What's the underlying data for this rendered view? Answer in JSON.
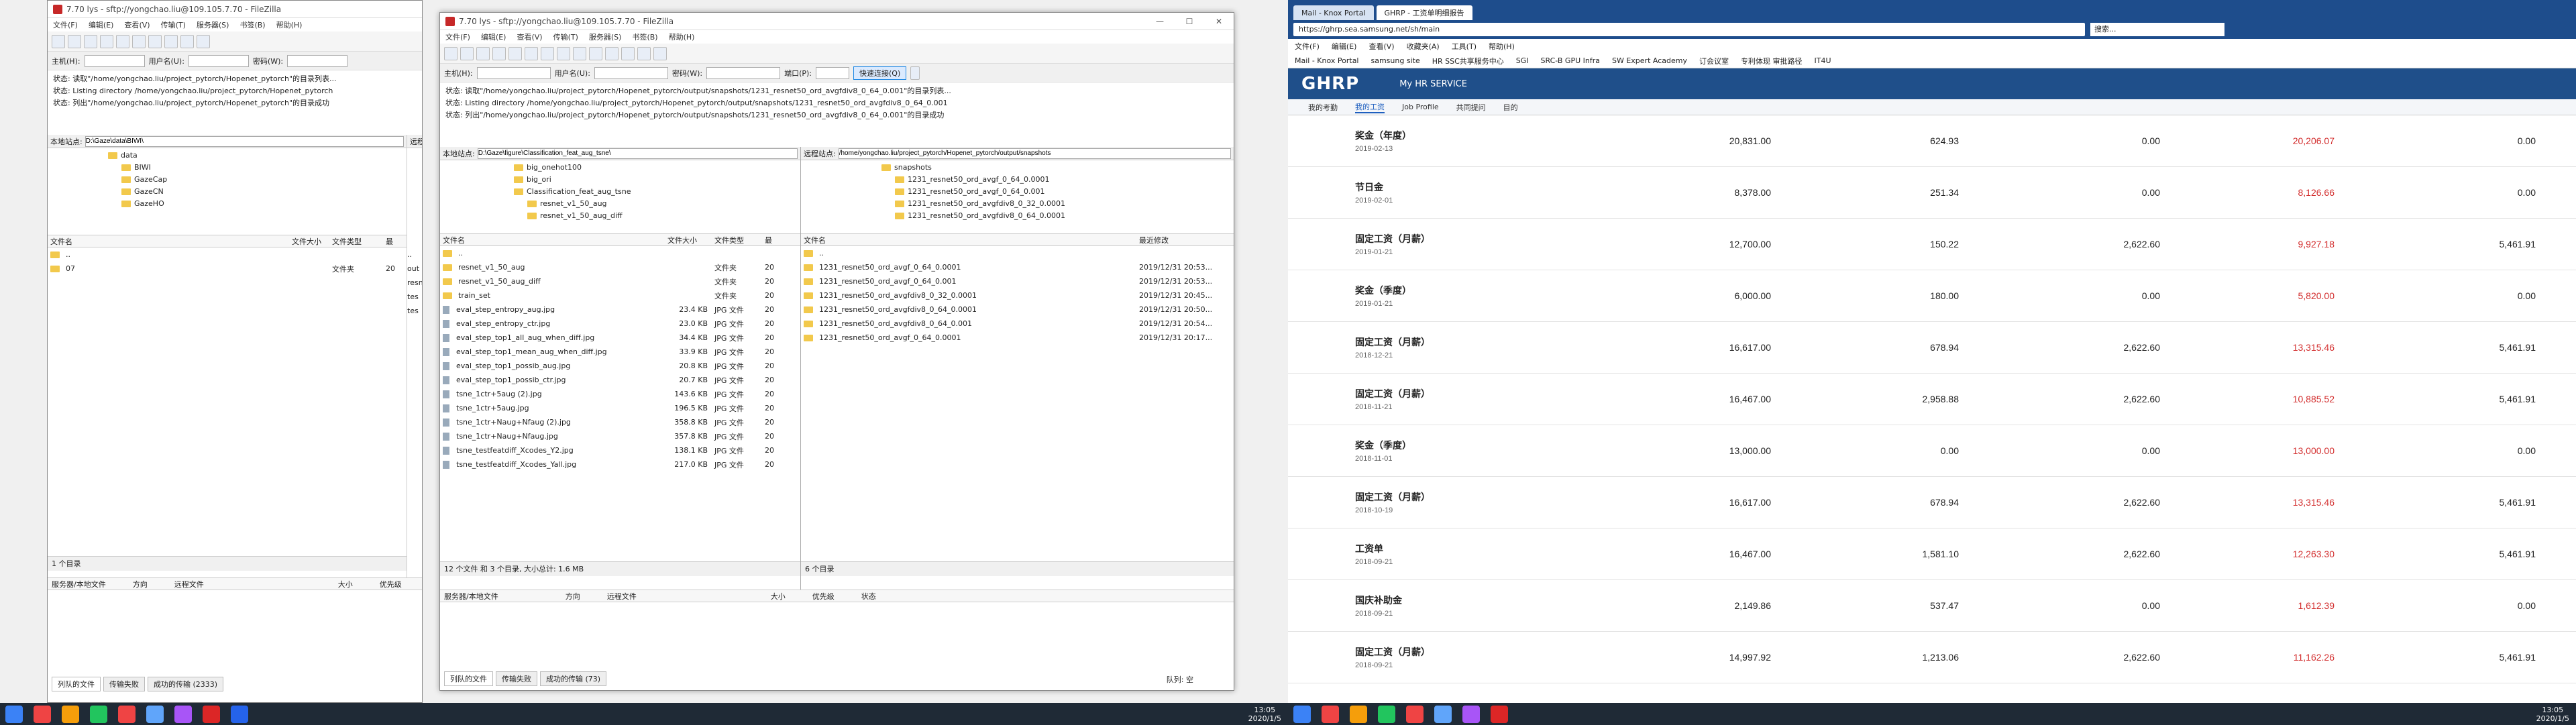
{
  "win1": {
    "title": "7.70 lys - sftp://yongchao.liu@109.105.7.70 - FileZilla",
    "menu": [
      "文件(F)",
      "编辑(E)",
      "查看(V)",
      "传输(T)",
      "服务器(S)",
      "书签(B)",
      "帮助(H)"
    ],
    "qc": {
      "host": "主机(H):",
      "user": "用户名(U):",
      "pass": "密码(W):"
    },
    "log": [
      "状态: 读取\"/home/yongchao.liu/project_pytorch/Hopenet_pytorch\"的目录列表...",
      "状态: Listing directory /home/yongchao.liu/project_pytorch/Hopenet_pytorch",
      "状态: 列出\"/home/yongchao.liu/project_pytorch/Hopenet_pytorch\"的目录成功"
    ],
    "local_label": "本地站点:",
    "local_path": "D:\\Gaze\\data\\BIWI\\",
    "remote_label": "远程站",
    "tree": [
      "data",
      "BIWI",
      "GazeCap",
      "GazeCN",
      "GazeHO"
    ],
    "cols": [
      "文件名",
      "文件大小",
      "文件类型",
      "最"
    ],
    "files": [
      {
        "name": "..",
        "size": "",
        "type": "",
        "date": ""
      },
      {
        "name": "07",
        "size": "",
        "type": "文件夹",
        "date": "20"
      }
    ],
    "remote_items": [
      "..",
      "out",
      "resne",
      "tes",
      "tes"
    ],
    "count": "1 个目录",
    "remote_count": "1 个",
    "qhead": [
      "服务器/本地文件",
      "方向",
      "远程文件",
      "大小",
      "优先级"
    ],
    "tabs": [
      "列队的文件",
      "传输失败",
      "成功的传输 (2333)"
    ]
  },
  "win2": {
    "title": "7.70 lys - sftp://yongchao.liu@109.105.7.70 - FileZilla",
    "menu": [
      "文件(F)",
      "编辑(E)",
      "查看(V)",
      "传输(T)",
      "服务器(S)",
      "书签(B)",
      "帮助(H)"
    ],
    "qc": {
      "host": "主机(H):",
      "user": "用户名(U):",
      "pass": "密码(W):",
      "port": "端口(P):",
      "btn": "快速连接(Q)"
    },
    "log": [
      "状态: 读取\"/home/yongchao.liu/project_pytorch/Hopenet_pytorch/output/snapshots/1231_resnet50_ord_avgfdiv8_0_64_0.001\"的目录列表...",
      "状态: Listing directory /home/yongchao.liu/project_pytorch/Hopenet_pytorch/output/snapshots/1231_resnet50_ord_avgfdiv8_0_64_0.001",
      "状态: 列出\"/home/yongchao.liu/project_pytorch/Hopenet_pytorch/output/snapshots/1231_resnet50_ord_avgfdiv8_0_64_0.001\"的目录成功"
    ],
    "local_label": "本地站点:",
    "local_path": "D:\\Gaze\\figure\\Classification_feat_aug_tsne\\",
    "remote_label": "远程站点:",
    "remote_path": "/home/yongchao.liu/project_pytorch/Hopenet_pytorch/output/snapshots",
    "ltree": [
      "big_onehot100",
      "big_ori",
      "Classification_feat_aug_tsne",
      "resnet_v1_50_aug",
      "resnet_v1_50_aug_diff"
    ],
    "rtree": [
      "snapshots",
      "1231_resnet50_ord_avgf_0_64_0.0001",
      "1231_resnet50_ord_avgf_0_64_0.001",
      "1231_resnet50_ord_avgfdiv8_0_32_0.0001",
      "1231_resnet50_ord_avgfdiv8_0_64_0.0001"
    ],
    "lcols": [
      "文件名",
      "文件大小",
      "文件类型",
      "最"
    ],
    "lfiles": [
      {
        "name": "..",
        "size": "",
        "type": "",
        "d": ""
      },
      {
        "name": "resnet_v1_50_aug",
        "size": "",
        "type": "文件夹",
        "d": "20"
      },
      {
        "name": "resnet_v1_50_aug_diff",
        "size": "",
        "type": "文件夹",
        "d": "20"
      },
      {
        "name": "train_set",
        "size": "",
        "type": "文件夹",
        "d": "20"
      },
      {
        "name": "eval_step_entropy_aug.jpg",
        "size": "23.4 KB",
        "type": "JPG 文件",
        "d": "20"
      },
      {
        "name": "eval_step_entropy_ctr.jpg",
        "size": "23.0 KB",
        "type": "JPG 文件",
        "d": "20"
      },
      {
        "name": "eval_step_top1_all_aug_when_diff.jpg",
        "size": "34.4 KB",
        "type": "JPG 文件",
        "d": "20"
      },
      {
        "name": "eval_step_top1_mean_aug_when_diff.jpg",
        "size": "33.9 KB",
        "type": "JPG 文件",
        "d": "20"
      },
      {
        "name": "eval_step_top1_possib_aug.jpg",
        "size": "20.8 KB",
        "type": "JPG 文件",
        "d": "20"
      },
      {
        "name": "eval_step_top1_possib_ctr.jpg",
        "size": "20.7 KB",
        "type": "JPG 文件",
        "d": "20"
      },
      {
        "name": "tsne_1ctr+5aug (2).jpg",
        "size": "143.6 KB",
        "type": "JPG 文件",
        "d": "20"
      },
      {
        "name": "tsne_1ctr+5aug.jpg",
        "size": "196.5 KB",
        "type": "JPG 文件",
        "d": "20"
      },
      {
        "name": "tsne_1ctr+Naug+Nfaug (2).jpg",
        "size": "358.8 KB",
        "type": "JPG 文件",
        "d": "20"
      },
      {
        "name": "tsne_1ctr+Naug+Nfaug.jpg",
        "size": "357.8 KB",
        "type": "JPG 文件",
        "d": "20"
      },
      {
        "name": "tsne_testfeatdiff_Xcodes_Y2.jpg",
        "size": "138.1 KB",
        "type": "JPG 文件",
        "d": "20"
      },
      {
        "name": "tsne_testfeatdiff_Xcodes_Yall.jpg",
        "size": "217.0 KB",
        "type": "JPG 文件",
        "d": "20"
      }
    ],
    "rcols": [
      "文件名",
      "最近修改"
    ],
    "rfiles": [
      {
        "name": "..",
        "d": ""
      },
      {
        "name": "1231_resnet50_ord_avgf_0_64_0.0001",
        "d": "2019/12/31 20:53..."
      },
      {
        "name": "1231_resnet50_ord_avgf_0_64_0.001",
        "d": "2019/12/31 20:53..."
      },
      {
        "name": "1231_resnet50_ord_avgfdiv8_0_32_0.0001",
        "d": "2019/12/31 20:45..."
      },
      {
        "name": "1231_resnet50_ord_avgfdiv8_0_64_0.0001",
        "d": "2019/12/31 20:50..."
      },
      {
        "name": "1231_resnet50_ord_avgfdiv8_0_64_0.001",
        "d": "2019/12/31 20:54..."
      },
      {
        "name": "1231_resnet50_ord_avgf_0_64_0.0001",
        "d": "2019/12/31 20:17..."
      }
    ],
    "lcount": "12 个文件 和 3 个目录, 大小总计: 1.6 MB",
    "rcount": "6 个目录",
    "qhead": [
      "服务器/本地文件",
      "方向",
      "远程文件",
      "大小",
      "优先级",
      "状态"
    ],
    "tabs": [
      "列队的文件",
      "传输失败",
      "成功的传输 (73)"
    ],
    "queue": "队列: 空"
  },
  "browser": {
    "tab1": "Mail - Knox Portal",
    "tab2": "GHRP - 工资单明细报告",
    "url": "https://ghrp.sea.samsung.net/sh/main",
    "search": "搜索...",
    "menu": [
      "文件(F)",
      "编辑(E)",
      "查看(V)",
      "收藏夹(A)",
      "工具(T)",
      "帮助(H)"
    ],
    "favs": [
      "Mail - Knox Portal",
      "samsung site",
      "HR SSC共享服务中心",
      "SGI",
      "SRC-B GPU Infra",
      "SW Expert Academy",
      "订会议室",
      "专利体现 审批路径",
      "IT4U"
    ],
    "logo": "GHRP",
    "service": "My HR SERVICE",
    "nav": [
      "我的考勤",
      "我的工资",
      "Job Profile",
      "共同提问",
      "目的"
    ],
    "rows": [
      {
        "t": "奖金（年度）",
        "d": "2019-02-13",
        "a": "20,831.00",
        "b": "624.93",
        "c": "0.00",
        "e": "20,206.07",
        "f": "0.00"
      },
      {
        "t": "节日金",
        "d": "2019-02-01",
        "a": "8,378.00",
        "b": "251.34",
        "c": "0.00",
        "e": "8,126.66",
        "f": "0.00"
      },
      {
        "t": "固定工资（月薪）",
        "d": "2019-01-21",
        "a": "12,700.00",
        "b": "150.22",
        "c": "2,622.60",
        "e": "9,927.18",
        "f": "5,461.91"
      },
      {
        "t": "奖金（季度）",
        "d": "2019-01-21",
        "a": "6,000.00",
        "b": "180.00",
        "c": "0.00",
        "e": "5,820.00",
        "f": "0.00"
      },
      {
        "t": "固定工资（月薪）",
        "d": "2018-12-21",
        "a": "16,617.00",
        "b": "678.94",
        "c": "2,622.60",
        "e": "13,315.46",
        "f": "5,461.91"
      },
      {
        "t": "固定工资（月薪）",
        "d": "2018-11-21",
        "a": "16,467.00",
        "b": "2,958.88",
        "c": "2,622.60",
        "e": "10,885.52",
        "f": "5,461.91"
      },
      {
        "t": "奖金（季度）",
        "d": "2018-11-01",
        "a": "13,000.00",
        "b": "0.00",
        "c": "0.00",
        "e": "13,000.00",
        "f": "0.00"
      },
      {
        "t": "固定工资（月薪）",
        "d": "2018-10-19",
        "a": "16,617.00",
        "b": "678.94",
        "c": "2,622.60",
        "e": "13,315.46",
        "f": "5,461.91"
      },
      {
        "t": "工资单",
        "d": "2018-09-21",
        "a": "16,467.00",
        "b": "1,581.10",
        "c": "2,622.60",
        "e": "12,263.30",
        "f": "5,461.91"
      },
      {
        "t": "国庆补助金",
        "d": "2018-09-21",
        "a": "2,149.86",
        "b": "537.47",
        "c": "0.00",
        "e": "1,612.39",
        "f": "0.00"
      },
      {
        "t": "固定工资（月薪）",
        "d": "2018-09-21",
        "a": "14,997.92",
        "b": "1,213.06",
        "c": "2,622.60",
        "e": "11,162.26",
        "f": "5,461.91"
      }
    ]
  },
  "clock": {
    "time": "13:05",
    "date": "2020/1/5"
  }
}
